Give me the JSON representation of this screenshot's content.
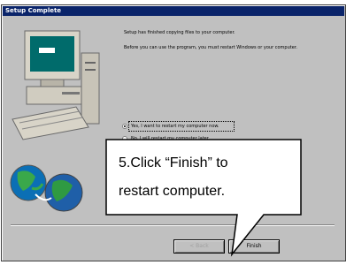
{
  "window": {
    "title": "Setup Complete"
  },
  "content": {
    "paragraph1": "Setup has finished copying files to your computer.",
    "paragraph2": "Before you can use the program, you must restart Windows or your computer.",
    "options": [
      {
        "label": "Yes, I want to restart my computer now.",
        "checked": true
      },
      {
        "label": "No, I will restart my computer later.",
        "checked": false
      }
    ],
    "finish_hint": "Click Finish to"
  },
  "buttons": {
    "back": "< Back",
    "finish": "Finish"
  },
  "callout": {
    "line1": "5.Click “Finish” to",
    "line2": "restart computer."
  },
  "colors": {
    "titlebar": "#0a246a",
    "dialog": "#c0c0c0"
  }
}
